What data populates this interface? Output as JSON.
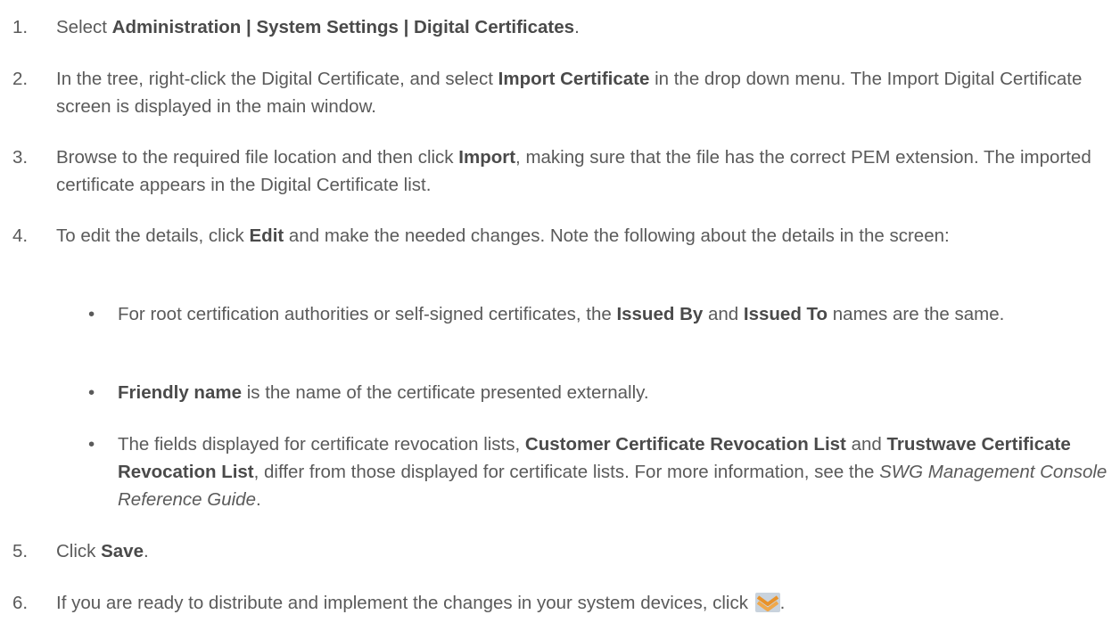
{
  "steps": [
    {
      "num": "1.",
      "parts": [
        {
          "t": "Select "
        },
        {
          "b": "Administration | System Settings | Digital Certificates"
        },
        {
          "t": "."
        }
      ]
    },
    {
      "num": "2.",
      "parts": [
        {
          "t": "In the tree, right-click the Digital Certificate, and select "
        },
        {
          "b": "Import Certificate"
        },
        {
          "t": " in the drop down menu. The Import Digital Certificate screen is displayed in the main window."
        }
      ]
    },
    {
      "num": "3.",
      "parts": [
        {
          "t": "Browse to the required file location and then click "
        },
        {
          "b": "Import"
        },
        {
          "t": ", making sure that the file has the correct PEM extension. The imported certificate appears in the Digital Certificate list."
        }
      ]
    },
    {
      "num": "4.",
      "parts": [
        {
          "t": "To edit the details, click "
        },
        {
          "b": "Edit"
        },
        {
          "t": " and make the needed changes. Note the following about the details in the screen:"
        }
      ]
    },
    {
      "num": "5.",
      "parts": [
        {
          "t": "Click "
        },
        {
          "b": "Save"
        },
        {
          "t": "."
        }
      ]
    },
    {
      "num": "6.",
      "parts": [
        {
          "t": "If you are ready to distribute and implement the changes in your system devices, click "
        },
        {
          "icon": "commit-changes-icon"
        },
        {
          "t": "."
        }
      ]
    }
  ],
  "bullet_char": "•",
  "bullets": [
    {
      "parts": [
        {
          "t": "For root certification authorities or self-signed certificates, the "
        },
        {
          "b": "Issued By"
        },
        {
          "t": " and "
        },
        {
          "b": "Issued To"
        },
        {
          "t": " names are the same."
        }
      ]
    },
    {
      "parts": [
        {
          "b": "Friendly name"
        },
        {
          "t": " is the name of the certificate presented externally."
        }
      ]
    },
    {
      "parts": [
        {
          "t": "The fields displayed for certificate revocation lists, "
        },
        {
          "b": "Customer Certificate Revocation List"
        },
        {
          "t": " and "
        },
        {
          "b": "Trustwave Certificate Revocation List"
        },
        {
          "t": ", differ from those displayed for certificate lists. For more information, see the "
        },
        {
          "i": "SWG Management Console Reference Guide"
        },
        {
          "t": "."
        }
      ]
    }
  ],
  "colors": {
    "text": "#5a5a5a",
    "icon_orange": "#e8922a",
    "icon_bg": "#b8c4d0"
  }
}
